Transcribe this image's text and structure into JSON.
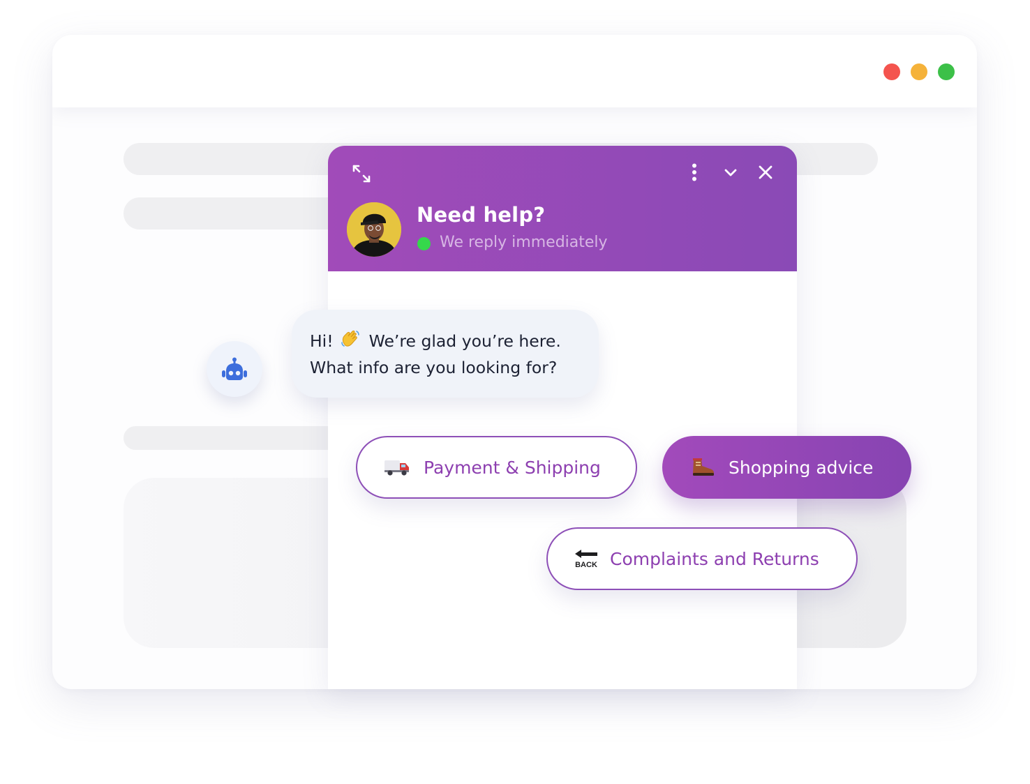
{
  "window_controls": {
    "close_color": "#f4544e",
    "minimize_color": "#f5b23a",
    "maximize_color": "#3cc048"
  },
  "chat_widget": {
    "title": "Need help?",
    "status_text": "We reply immediately",
    "status_color": "#35d84b",
    "header_colors": [
      "#a14bb9",
      "#8a4ab6"
    ],
    "icons": {
      "expand": "expand-icon",
      "menu": "more-vertical-icon",
      "minimize": "chevron-down-icon",
      "close": "close-icon"
    }
  },
  "bot": {
    "icon": "robot-icon",
    "message_line1_prefix": "Hi!",
    "message_line1_suffix": "We’re glad you’re here.",
    "message_line2": "What info are you looking for?",
    "emoji": "waving-hand-icon"
  },
  "options": [
    {
      "label": "Payment & Shipping",
      "icon": "delivery-truck-icon",
      "style": "outline"
    },
    {
      "label": "Shopping advice",
      "icon": "hiking-boot-icon",
      "style": "filled"
    },
    {
      "label": "Complaints and Returns",
      "icon": "back-arrow-icon",
      "icon_text": "BACK",
      "style": "outline"
    }
  ]
}
